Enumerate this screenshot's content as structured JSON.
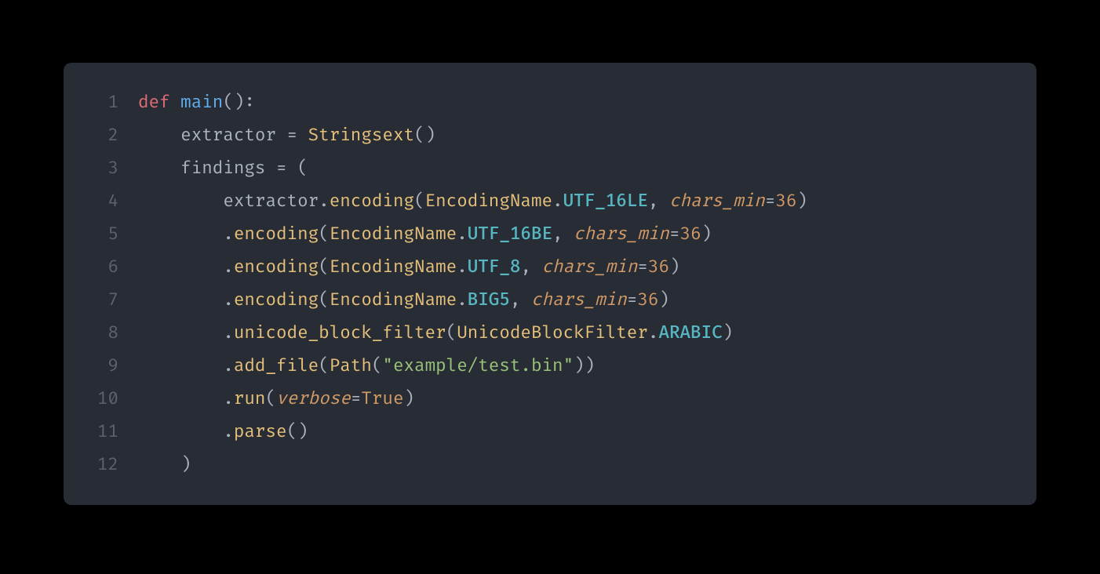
{
  "code": {
    "lines": [
      {
        "num": "1",
        "tokens": [
          {
            "t": "def ",
            "c": "tok-keyword"
          },
          {
            "t": "main",
            "c": "tok-def"
          },
          {
            "t": "():",
            "c": "tok-punct"
          }
        ]
      },
      {
        "num": "2",
        "tokens": [
          {
            "t": "    ",
            "c": "tok-plain"
          },
          {
            "t": "extractor ",
            "c": "tok-plain"
          },
          {
            "t": "=",
            "c": "tok-op"
          },
          {
            "t": " ",
            "c": "tok-plain"
          },
          {
            "t": "Stringsext",
            "c": "tok-class"
          },
          {
            "t": "()",
            "c": "tok-punct"
          }
        ]
      },
      {
        "num": "3",
        "tokens": [
          {
            "t": "    ",
            "c": "tok-plain"
          },
          {
            "t": "findings ",
            "c": "tok-plain"
          },
          {
            "t": "=",
            "c": "tok-op"
          },
          {
            "t": " (",
            "c": "tok-punct"
          }
        ]
      },
      {
        "num": "4",
        "tokens": [
          {
            "t": "        ",
            "c": "tok-plain"
          },
          {
            "t": "extractor",
            "c": "tok-plain"
          },
          {
            "t": ".",
            "c": "tok-punct"
          },
          {
            "t": "encoding",
            "c": "tok-method"
          },
          {
            "t": "(",
            "c": "tok-punct"
          },
          {
            "t": "EncodingName",
            "c": "tok-class"
          },
          {
            "t": ".",
            "c": "tok-punct"
          },
          {
            "t": "UTF_16LE",
            "c": "tok-const"
          },
          {
            "t": ", ",
            "c": "tok-punct"
          },
          {
            "t": "chars_min",
            "c": "tok-kwarg"
          },
          {
            "t": "=",
            "c": "tok-op"
          },
          {
            "t": "36",
            "c": "tok-number"
          },
          {
            "t": ")",
            "c": "tok-punct"
          }
        ]
      },
      {
        "num": "5",
        "tokens": [
          {
            "t": "        ",
            "c": "tok-plain"
          },
          {
            "t": ".",
            "c": "tok-punct"
          },
          {
            "t": "encoding",
            "c": "tok-method"
          },
          {
            "t": "(",
            "c": "tok-punct"
          },
          {
            "t": "EncodingName",
            "c": "tok-class"
          },
          {
            "t": ".",
            "c": "tok-punct"
          },
          {
            "t": "UTF_16BE",
            "c": "tok-const"
          },
          {
            "t": ", ",
            "c": "tok-punct"
          },
          {
            "t": "chars_min",
            "c": "tok-kwarg"
          },
          {
            "t": "=",
            "c": "tok-op"
          },
          {
            "t": "36",
            "c": "tok-number"
          },
          {
            "t": ")",
            "c": "tok-punct"
          }
        ]
      },
      {
        "num": "6",
        "tokens": [
          {
            "t": "        ",
            "c": "tok-plain"
          },
          {
            "t": ".",
            "c": "tok-punct"
          },
          {
            "t": "encoding",
            "c": "tok-method"
          },
          {
            "t": "(",
            "c": "tok-punct"
          },
          {
            "t": "EncodingName",
            "c": "tok-class"
          },
          {
            "t": ".",
            "c": "tok-punct"
          },
          {
            "t": "UTF_8",
            "c": "tok-const"
          },
          {
            "t": ", ",
            "c": "tok-punct"
          },
          {
            "t": "chars_min",
            "c": "tok-kwarg"
          },
          {
            "t": "=",
            "c": "tok-op"
          },
          {
            "t": "36",
            "c": "tok-number"
          },
          {
            "t": ")",
            "c": "tok-punct"
          }
        ]
      },
      {
        "num": "7",
        "tokens": [
          {
            "t": "        ",
            "c": "tok-plain"
          },
          {
            "t": ".",
            "c": "tok-punct"
          },
          {
            "t": "encoding",
            "c": "tok-method"
          },
          {
            "t": "(",
            "c": "tok-punct"
          },
          {
            "t": "EncodingName",
            "c": "tok-class"
          },
          {
            "t": ".",
            "c": "tok-punct"
          },
          {
            "t": "BIG5",
            "c": "tok-const"
          },
          {
            "t": ", ",
            "c": "tok-punct"
          },
          {
            "t": "chars_min",
            "c": "tok-kwarg"
          },
          {
            "t": "=",
            "c": "tok-op"
          },
          {
            "t": "36",
            "c": "tok-number"
          },
          {
            "t": ")",
            "c": "tok-punct"
          }
        ]
      },
      {
        "num": "8",
        "tokens": [
          {
            "t": "        ",
            "c": "tok-plain"
          },
          {
            "t": ".",
            "c": "tok-punct"
          },
          {
            "t": "unicode_block_filter",
            "c": "tok-method"
          },
          {
            "t": "(",
            "c": "tok-punct"
          },
          {
            "t": "UnicodeBlockFilter",
            "c": "tok-class"
          },
          {
            "t": ".",
            "c": "tok-punct"
          },
          {
            "t": "ARABIC",
            "c": "tok-const"
          },
          {
            "t": ")",
            "c": "tok-punct"
          }
        ]
      },
      {
        "num": "9",
        "tokens": [
          {
            "t": "        ",
            "c": "tok-plain"
          },
          {
            "t": ".",
            "c": "tok-punct"
          },
          {
            "t": "add_file",
            "c": "tok-method"
          },
          {
            "t": "(",
            "c": "tok-punct"
          },
          {
            "t": "Path",
            "c": "tok-class"
          },
          {
            "t": "(",
            "c": "tok-punct"
          },
          {
            "t": "\"example/test.bin\"",
            "c": "tok-string"
          },
          {
            "t": "))",
            "c": "tok-punct"
          }
        ]
      },
      {
        "num": "10",
        "tokens": [
          {
            "t": "        ",
            "c": "tok-plain"
          },
          {
            "t": ".",
            "c": "tok-punct"
          },
          {
            "t": "run",
            "c": "tok-method"
          },
          {
            "t": "(",
            "c": "tok-punct"
          },
          {
            "t": "verbose",
            "c": "tok-kwarg"
          },
          {
            "t": "=",
            "c": "tok-op"
          },
          {
            "t": "True",
            "c": "tok-bool"
          },
          {
            "t": ")",
            "c": "tok-punct"
          }
        ]
      },
      {
        "num": "11",
        "tokens": [
          {
            "t": "        ",
            "c": "tok-plain"
          },
          {
            "t": ".",
            "c": "tok-punct"
          },
          {
            "t": "parse",
            "c": "tok-method"
          },
          {
            "t": "()",
            "c": "tok-punct"
          }
        ]
      },
      {
        "num": "12",
        "tokens": [
          {
            "t": "    ",
            "c": "tok-plain"
          },
          {
            "t": ")",
            "c": "tok-punct"
          }
        ]
      }
    ]
  }
}
